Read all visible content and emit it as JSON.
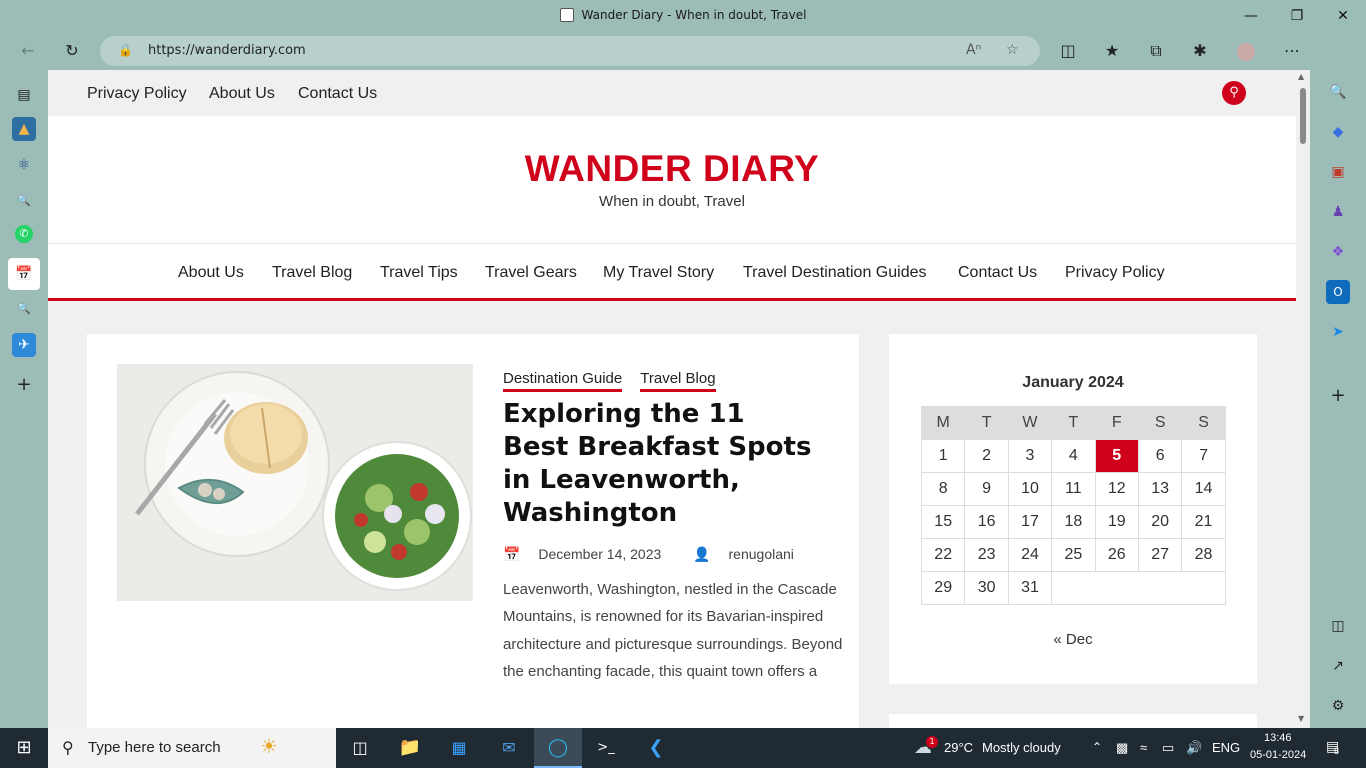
{
  "window": {
    "title": "Wander Diary - When in doubt, Travel"
  },
  "browser": {
    "url": "https://wanderdiary.com"
  },
  "site": {
    "topnav": [
      "Privacy Policy",
      "About Us",
      "Contact Us"
    ],
    "title": "WANDER DIARY",
    "tagline": "When in doubt, Travel",
    "mainnav": [
      "About Us",
      "Travel Blog",
      "Travel Tips",
      "Travel Gears",
      "My Travel Story",
      "Travel Destination Guides",
      "Contact Us",
      "Privacy Policy"
    ],
    "accent": "#d0021b"
  },
  "post": {
    "categories": [
      "Destination Guide",
      "Travel Blog"
    ],
    "title": "Exploring the 11 Best Breakfast Spots in Leavenworth, Washington",
    "date": "December 14, 2023",
    "author": "renugolani",
    "excerpt": "Leavenworth, Washington, nestled in the Cascade Mountains, is renowned for its Bavarian-inspired architecture and picturesque surroundings. Beyond the enchanting facade, this quaint town offers a"
  },
  "calendar": {
    "caption": "January 2024",
    "weekdays": [
      "M",
      "T",
      "W",
      "T",
      "F",
      "S",
      "S"
    ],
    "weeks": [
      [
        "1",
        "2",
        "3",
        "4",
        "5",
        "6",
        "7"
      ],
      [
        "8",
        "9",
        "10",
        "11",
        "12",
        "13",
        "14"
      ],
      [
        "15",
        "16",
        "17",
        "18",
        "19",
        "20",
        "21"
      ],
      [
        "22",
        "23",
        "24",
        "25",
        "26",
        "27",
        "28"
      ],
      [
        "29",
        "30",
        "31",
        "",
        "",
        "",
        ""
      ]
    ],
    "today": "5",
    "prev": "« Dec"
  },
  "taskbar": {
    "search_placeholder": "Type here to search",
    "weather_temp": "29°C",
    "weather_desc": "Mostly cloudy",
    "weather_badge": "1",
    "lang": "ENG",
    "time": "13:46",
    "date": "05-01-2024",
    "notif_count": "8"
  }
}
